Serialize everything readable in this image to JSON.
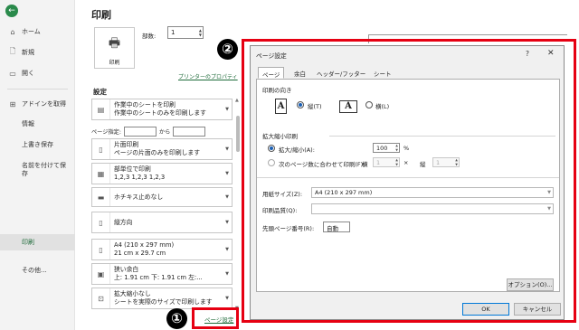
{
  "sidebar": {
    "back_icon": "back-arrow-icon",
    "items": [
      {
        "label": "ホーム",
        "icon": "home-icon"
      },
      {
        "label": "新規",
        "icon": "new-file-icon"
      },
      {
        "label": "開く",
        "icon": "folder-open-icon"
      },
      {
        "label": "アドインを取得",
        "icon": "grid-icon"
      },
      {
        "label": "情報"
      },
      {
        "label": "上書き保存"
      },
      {
        "label": "名前を付けて保存"
      },
      {
        "label": "印刷"
      },
      {
        "label": "その他..."
      }
    ]
  },
  "print_panel": {
    "title": "印刷",
    "print_button": "印刷",
    "copies_label": "部数:",
    "copies_value": "1",
    "printer_properties": "プリンターのプロパティ",
    "settings_header": "設定",
    "pages_label": "ページ指定:",
    "pages_to": "から",
    "options": [
      {
        "line1": "作業中のシートを印刷",
        "line2": "作業中のシートのみを印刷します"
      },
      {
        "line1": "片面印刷",
        "line2": "ページの片面のみを印刷します"
      },
      {
        "line1": "部単位で印刷",
        "line2": "1,2,3    1,2,3    1,2,3"
      },
      {
        "line1": "ホチキス止めなし",
        "line2": ""
      },
      {
        "line1": "縦方向",
        "line2": ""
      },
      {
        "line1": "A4 (210 x 297 mm)",
        "line2": "21 cm x 29.7 cm"
      },
      {
        "line1": "狭い余白",
        "line2": "上: 1.91 cm 下: 1.91 cm 左:..."
      },
      {
        "line1": "拡大縮小なし",
        "line2": "シートを実際のサイズで印刷します"
      }
    ],
    "page_setup_link": "ページ設定"
  },
  "callouts": {
    "one": "①",
    "two": "②"
  },
  "accent_color": "#e60012",
  "dialog": {
    "title": "ページ設定",
    "help": "?",
    "close": "✕",
    "tabs": [
      "ページ",
      "余白",
      "ヘッダー/フッター",
      "シート"
    ],
    "orientation_label": "印刷の向き",
    "portrait": "縦(T)",
    "landscape": "横(L)",
    "scaling_label": "拡大縮小印刷",
    "zoom_label": "拡大/縮小(A):",
    "zoom_value": "100",
    "zoom_unit": "%",
    "fit_label": "次のページ数に合わせて印刷(F):",
    "fit_wide_label": "横",
    "fit_wide_value": "1",
    "fit_times": "×",
    "fit_tall_label": "縦",
    "fit_tall_value": "1",
    "paper_size_label": "用紙サイズ(Z):",
    "paper_size_value": "A4 (210 x 297 mm)",
    "print_quality_label": "印刷品質(Q):",
    "print_quality_value": "",
    "first_page_label": "先頭ページ番号(R):",
    "first_page_value": "自動",
    "options_button": "オプション(O)...",
    "ok_button": "OK",
    "cancel_button": "キャンセル"
  }
}
